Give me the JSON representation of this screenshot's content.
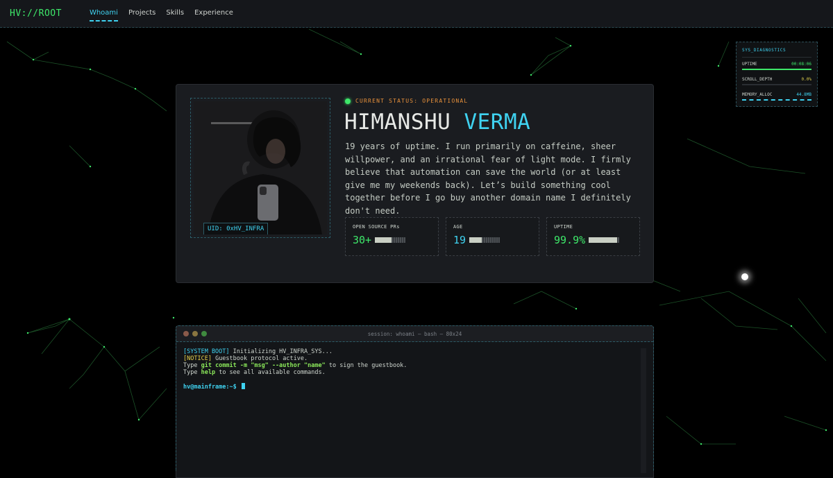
{
  "nav": {
    "logo": "HV://ROOT",
    "links": [
      "Whoami",
      "Projects",
      "Skills",
      "Experience"
    ],
    "active_index": 0
  },
  "diagnostics": {
    "title": "SYS_DIAGNOSTICS",
    "rows": [
      {
        "label": "UPTIME",
        "value": "00:08:06"
      },
      {
        "label": "SCROLL_DEPTH",
        "value": "0.0%"
      },
      {
        "label": "MEMORY_ALLOC",
        "value": "44.8MB"
      }
    ]
  },
  "profile": {
    "uid": "UID: 0xHV_INFRA",
    "status": "CURRENT STATUS: OPERATIONAL",
    "first_name": "HIMANSHU",
    "last_name": "VERMA",
    "bio": "19 years of uptime. I run primarily on caffeine, sheer willpower, and an irrational fear of light mode. I firmly believe that automation can save the world (or at least give me my weekends back). Let’s build something cool together before I go buy another domain name I definitely don't need.",
    "stats": [
      {
        "label": "OPEN SOURCE PRs",
        "value": "30+",
        "fill_pct": 55
      },
      {
        "label": "AGE",
        "value": "19",
        "fill_pct": 40
      },
      {
        "label": "UPTIME",
        "value": "99.9%",
        "fill_pct": 92
      }
    ]
  },
  "terminal": {
    "title": "session: whoami — bash — 80x24",
    "lines": {
      "boot_tag": "[SYSTEM BOOT]",
      "boot_text": " Initializing HV_INFRA_SYS...",
      "notice_tag": "[NOTICE]",
      "notice_text": " Guestbook protocol active.",
      "l3_a": "Type ",
      "l3_cmd": "git commit -m \"msg\" --author \"name\"",
      "l3_b": " to sign the guestbook.",
      "l4_a": "Type ",
      "l4_cmd": "help",
      "l4_b": " to see all available commands."
    },
    "prompt": "hv@mainframe:~$"
  },
  "colors": {
    "accent_cyan": "#3fd2f0",
    "accent_green": "#3ee86a",
    "status_orange": "#e8913b",
    "dot_red": "#e26d5a",
    "dot_yellow": "#e0b341",
    "dot_green": "#5ac05a"
  }
}
